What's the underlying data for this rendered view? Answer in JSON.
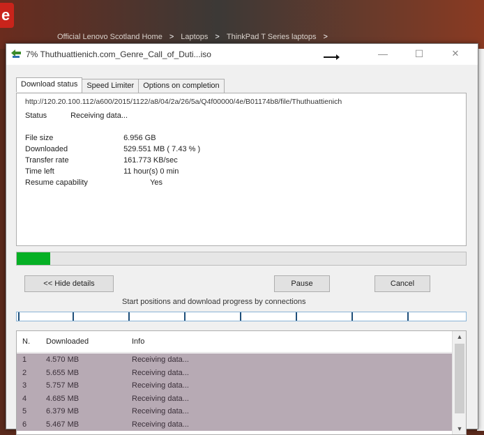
{
  "background": {
    "breadcrumbs": [
      "Official Lenovo Scotland Home",
      ">",
      "Laptops",
      ">",
      "ThinkPad T Series laptops",
      ">"
    ]
  },
  "window": {
    "title": "7% Thuthuattienich.com_Genre_Call_of_Duti...iso",
    "controls": {
      "minimize": "—",
      "maximize": "☐",
      "close": "✕"
    }
  },
  "tabs": [
    "Download status",
    "Speed Limiter",
    "Options on completion"
  ],
  "status_panel": {
    "url": "http://120.20.100.112/a600/2015/1122/a8/04/2a/26/5a/Q4f00000/4e/B01174b8/file/Thuthuattienich",
    "status_label": "Status",
    "status_value": "Receiving data...",
    "rows": [
      {
        "label": "File size",
        "value": "6.956 GB"
      },
      {
        "label": "Downloaded",
        "value": "529.551 MB ( 7.43 % )"
      },
      {
        "label": "Transfer rate",
        "value": "161.773 KB/sec"
      },
      {
        "label": "Time left",
        "value": "11 hour(s) 0 min"
      },
      {
        "label": "Resume capability",
        "value": "Yes"
      }
    ]
  },
  "progress": {
    "percent": 7.43,
    "color": "#06b025"
  },
  "buttons": {
    "hide_details": "<< Hide details",
    "pause": "Pause",
    "cancel": "Cancel"
  },
  "connections_label": "Start positions and download progress by connections",
  "connections": {
    "header": {
      "n": "N.",
      "downloaded": "Downloaded",
      "info": "Info"
    },
    "rows": [
      {
        "n": "1",
        "downloaded": "4.570 MB",
        "info": "Receiving data..."
      },
      {
        "n": "2",
        "downloaded": "5.655 MB",
        "info": "Receiving data..."
      },
      {
        "n": "3",
        "downloaded": "5.757 MB",
        "info": "Receiving data..."
      },
      {
        "n": "4",
        "downloaded": "4.685 MB",
        "info": "Receiving data..."
      },
      {
        "n": "5",
        "downloaded": "6.379 MB",
        "info": "Receiving data..."
      },
      {
        "n": "6",
        "downloaded": "5.467 MB",
        "info": "Receiving data..."
      }
    ]
  },
  "icons": {
    "app": "idm-icon",
    "scroll_up": "▲",
    "scroll_down": "▼"
  }
}
